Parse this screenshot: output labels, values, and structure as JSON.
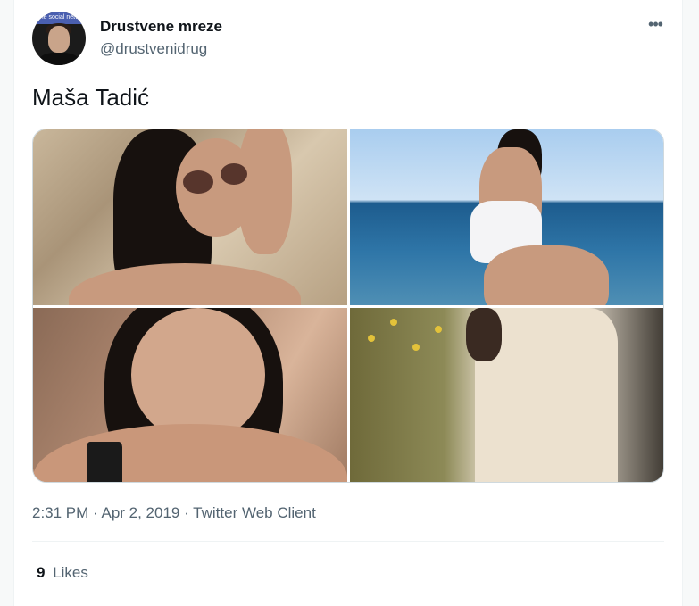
{
  "author": {
    "display_name": "Drustvene mreze",
    "handle": "@drustvenidrug",
    "avatar_banner_text": "the social netw"
  },
  "more_options_glyph": "•••",
  "tweet": {
    "text": "Maša Tadić",
    "timestamp": "2:31 PM · Apr 2, 2019 · Twitter Web Client"
  },
  "media": {
    "photo_count": 4,
    "photos": [
      {
        "icon": "photo-rocks-sunglasses"
      },
      {
        "icon": "photo-sea-swimsuit"
      },
      {
        "icon": "photo-selfie-smile"
      },
      {
        "icon": "photo-white-coat"
      }
    ]
  },
  "engagement": {
    "likes_count": "9",
    "likes_label": "Likes"
  },
  "colors": {
    "primary_text": "#0f1419",
    "secondary_text": "#536471",
    "divider": "#eff3f4",
    "border": "#cfd9de"
  }
}
